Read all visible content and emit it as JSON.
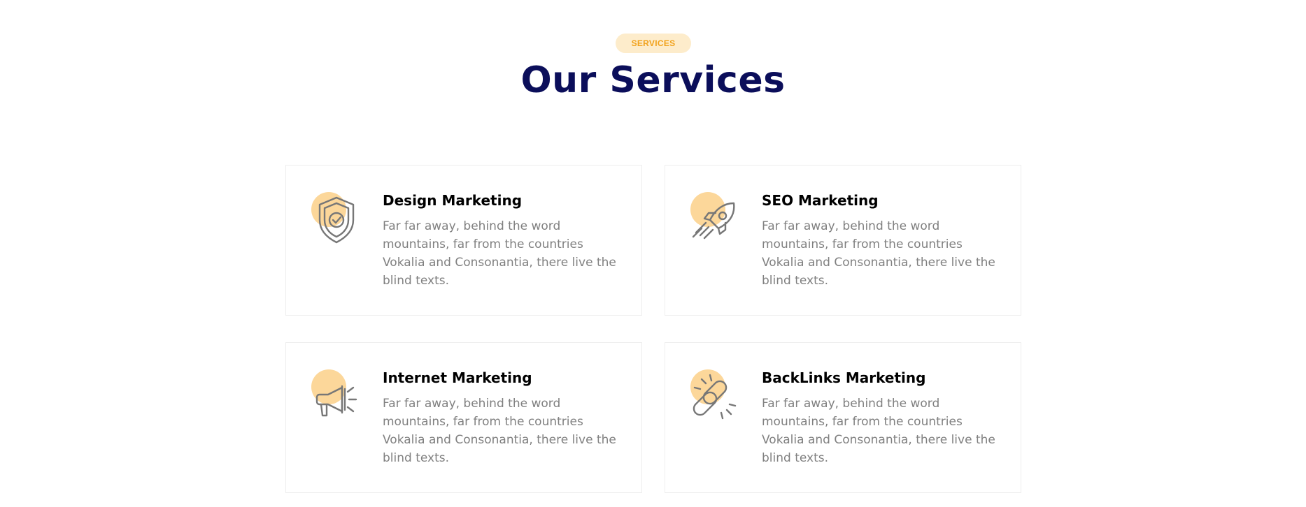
{
  "section": {
    "badge": "SERVICES",
    "title": "Our Services"
  },
  "colors": {
    "title": "#0b0e5a",
    "badge_bg": "#fdeccb",
    "badge_text": "#f1a21c",
    "icon_dot": "#fcd79a",
    "icon_stroke": "#777777",
    "body_text": "#808080"
  },
  "services": [
    {
      "icon": "shield-check-icon",
      "title": "Design Marketing",
      "description": "Far far away, behind the word mountains, far from the countries Vokalia and Consonantia, there live the blind texts."
    },
    {
      "icon": "rocket-icon",
      "title": "SEO Marketing",
      "description": "Far far away, behind the word mountains, far from the countries Vokalia and Consonantia, there live the blind texts."
    },
    {
      "icon": "megaphone-icon",
      "title": "Internet Marketing",
      "description": "Far far away, behind the word mountains, far from the countries Vokalia and Consonantia, there live the blind texts."
    },
    {
      "icon": "chain-link-icon",
      "title": "BackLinks Marketing",
      "description": "Far far away, behind the word mountains, far from the countries Vokalia and Consonantia, there live the blind texts."
    }
  ]
}
